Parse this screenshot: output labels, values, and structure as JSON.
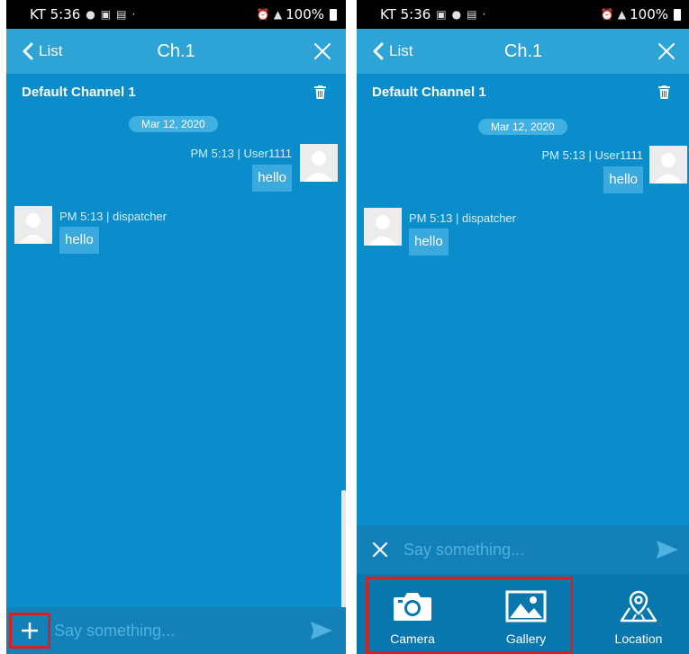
{
  "status_bar": {
    "carrier_time": "KT 5:36",
    "battery": "100%",
    "left_icons": [
      "notification-icon",
      "gallery-notify-icon",
      "tc-app-icon"
    ],
    "right_icons": [
      "alarm-icon",
      "mute-icon",
      "volte-icon",
      "wifi-icon",
      "signal-icon",
      "battery-icon"
    ]
  },
  "navbar": {
    "back_label": "List",
    "title": "Ch.1"
  },
  "channel": {
    "name": "Default Channel 1"
  },
  "chat": {
    "date": "Mar 12, 2020",
    "messages": [
      {
        "side": "right",
        "meta": "PM 5:13 | User1111",
        "text": "hello"
      },
      {
        "side": "left",
        "meta": "PM 5:13 | dispatcher",
        "text": "hello"
      }
    ]
  },
  "input": {
    "placeholder": "Say something..."
  },
  "attach_menu": {
    "items": [
      {
        "label": "Camera",
        "icon": "camera-icon"
      },
      {
        "label": "Gallery",
        "icon": "gallery-icon"
      },
      {
        "label": "Location",
        "icon": "map-location-icon"
      }
    ]
  },
  "colors": {
    "background": "#0b8dcc",
    "navbar": "#2ea3d6",
    "input_bar": "#1380b8",
    "attach_bar": "#0777ad",
    "highlight": "#d9201e"
  }
}
